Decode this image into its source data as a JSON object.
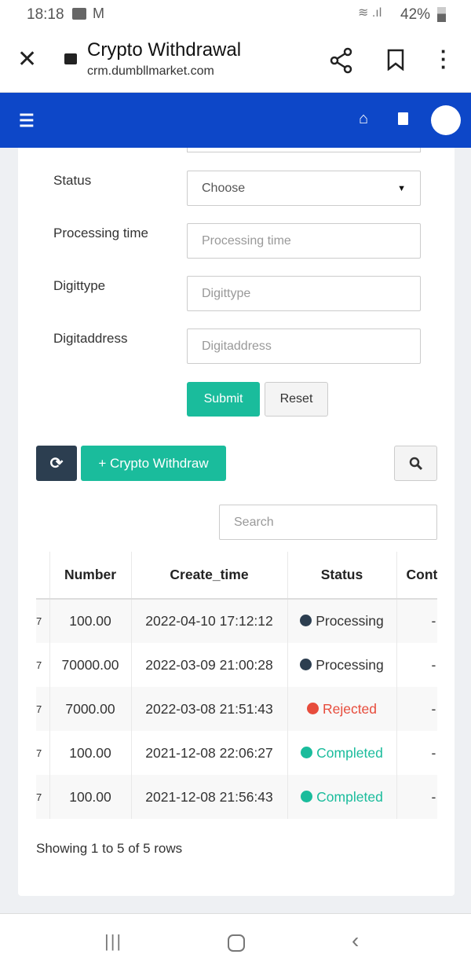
{
  "status_bar": {
    "time": "18:18",
    "battery": "42%"
  },
  "browser": {
    "title": "Crypto Withdrawal",
    "url": "crm.dumbllmarket.com"
  },
  "form": {
    "status_label": "Status",
    "status_value": "Choose",
    "processing_label": "Processing time",
    "processing_placeholder": "Processing time",
    "digittype_label": "Digittype",
    "digittype_placeholder": "Digittype",
    "digitaddress_label": "Digitaddress",
    "digitaddress_placeholder": "Digitaddress",
    "submit": "Submit",
    "reset": "Reset"
  },
  "toolbar": {
    "add_label": "+ Crypto Withdraw",
    "search_placeholder": "Search"
  },
  "table": {
    "headers": [
      "",
      "Number",
      "Create_time",
      "Status",
      "Cont"
    ],
    "rows": [
      {
        "c0": "7",
        "number": "100.00",
        "time": "2022-04-10 17:12:12",
        "status": "Processing",
        "cont": "-"
      },
      {
        "c0": "7",
        "number": "70000.00",
        "time": "2022-03-09 21:00:28",
        "status": "Processing",
        "cont": "-"
      },
      {
        "c0": "7",
        "number": "7000.00",
        "time": "2022-03-08 21:51:43",
        "status": "Rejected",
        "cont": "-"
      },
      {
        "c0": "7",
        "number": "100.00",
        "time": "2021-12-08 22:06:27",
        "status": "Completed",
        "cont": "-"
      },
      {
        "c0": "7",
        "number": "100.00",
        "time": "2021-12-08 21:56:43",
        "status": "Completed",
        "cont": "-"
      }
    ],
    "footer": "Showing 1 to 5 of 5 rows"
  },
  "colors": {
    "primary": "#0d47c8",
    "teal": "#1abc9c",
    "dark": "#2c3e50",
    "red": "#e74c3c"
  }
}
